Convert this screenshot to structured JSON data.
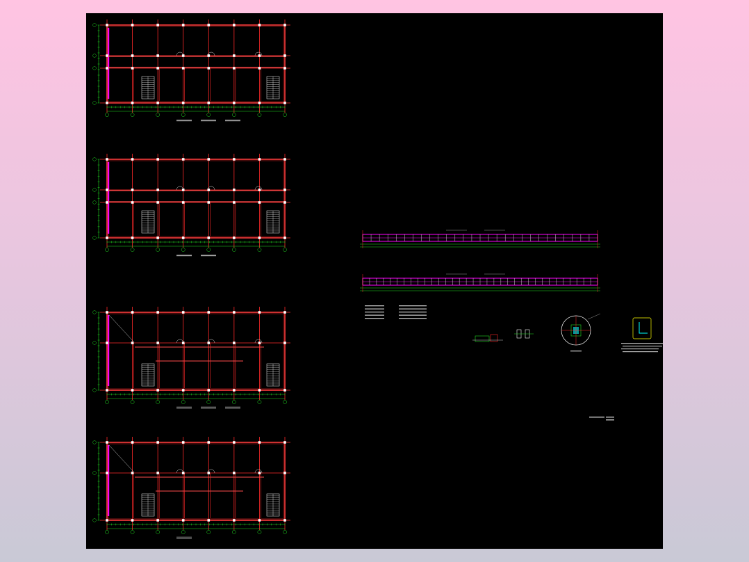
{
  "drawing": {
    "background": "#000000",
    "colors": {
      "grid": "#ff2a2a",
      "wall": "#ff4d4d",
      "dim": "#22dd22",
      "column": "#ffffff",
      "accent": "#ff00ff",
      "text": "#ffffff",
      "stair": "#ffffff",
      "cyan": "#00ffff",
      "yellow": "#ffff00"
    },
    "floor_plans": [
      {
        "name": "floor-plan-1",
        "columns": 8,
        "rows": 4,
        "stairs": "both-ends",
        "notes": [
          "",
          "",
          ""
        ]
      },
      {
        "name": "floor-plan-2",
        "columns": 8,
        "rows": 4,
        "stairs": "both-ends",
        "notes": [
          "",
          ""
        ]
      },
      {
        "name": "floor-plan-3",
        "columns": 8,
        "rows": 3,
        "stairs": "both-ends",
        "notes": [
          "",
          "",
          ""
        ]
      },
      {
        "name": "floor-plan-4",
        "columns": 8,
        "rows": 3,
        "stairs": "both-ends",
        "notes": [
          ""
        ]
      }
    ],
    "elevations": [
      {
        "name": "elevation-strip-1",
        "bays": 28
      },
      {
        "name": "elevation-strip-2",
        "bays": 34
      }
    ],
    "details": [
      {
        "name": "detail-node-a"
      },
      {
        "name": "detail-node-b"
      },
      {
        "name": "detail-circle"
      },
      {
        "name": "detail-corner"
      }
    ],
    "notes_block": {
      "lines": [
        "",
        "",
        "",
        "",
        ""
      ]
    },
    "stamp": {
      "text": ""
    }
  }
}
